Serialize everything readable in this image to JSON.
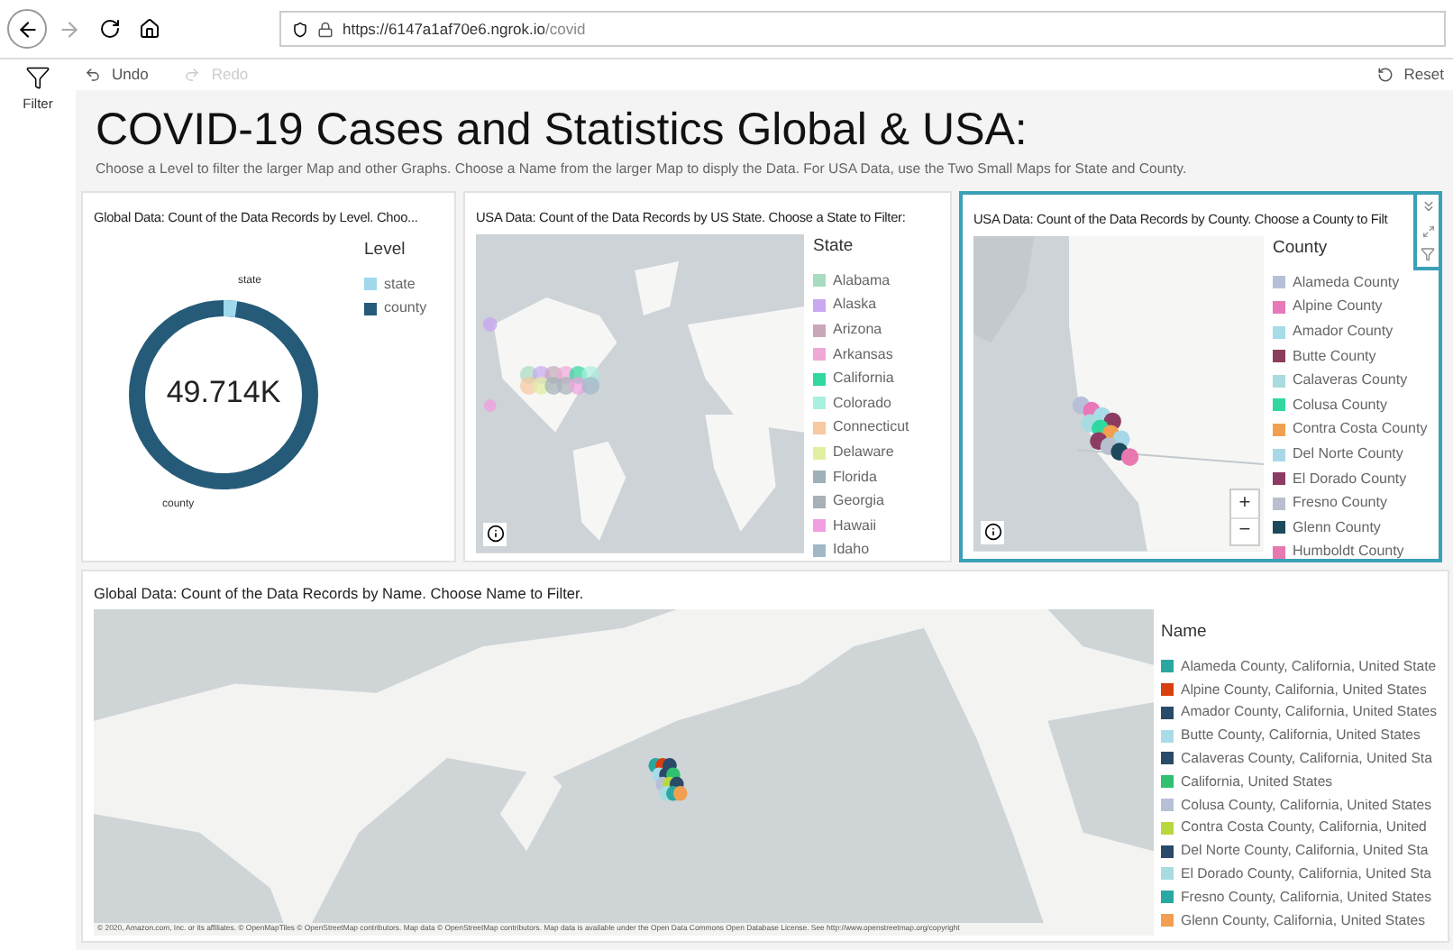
{
  "browser": {
    "url_host": "https://6147a1af70e6.ngrok.io",
    "url_path": "/covid"
  },
  "sidebar": {
    "items": [
      {
        "label": "Filter"
      }
    ]
  },
  "toolbar": {
    "undo": {
      "label": "Undo",
      "disabled": false
    },
    "redo": {
      "label": "Redo",
      "disabled": true
    },
    "reset": {
      "label": "Reset",
      "disabled": false
    }
  },
  "title": "COVID-19 Cases and Statistics Global & USA:",
  "subtitle": "Choose a Level to filter the larger Map and other Graphs. Choose a Name from the larger Map to disply the Data. For USA Data, use the Two Small Maps for State and County.",
  "visuals": [
    {
      "kind": "donut",
      "title": "Global Data: Count of the Data Records by Level. Choo...",
      "selected": false,
      "total": "49.714K",
      "slice_labels": [
        "state",
        "county"
      ],
      "legend": {
        "title": "Level",
        "items": [
          {
            "label": "state",
            "color": "#a0d8ec"
          },
          {
            "label": "county",
            "color": "#255b78"
          }
        ]
      }
    },
    {
      "kind": "map",
      "title": "USA Data: Count of the Data Records by US State. Choose a State to Filter:",
      "selected": false,
      "zoom_controls": false,
      "legend": {
        "title": "State",
        "items": [
          {
            "label": "Alabama",
            "color": "#a8dcc0"
          },
          {
            "label": "Alaska",
            "color": "#c8a8f0"
          },
          {
            "label": "Arizona",
            "color": "#c8a8b8"
          },
          {
            "label": "Arkansas",
            "color": "#f0a8d8"
          },
          {
            "label": "California",
            "color": "#30d8a0"
          },
          {
            "label": "Colorado",
            "color": "#a8f0e0"
          },
          {
            "label": "Connecticut",
            "color": "#f8c8a0"
          },
          {
            "label": "Delaware",
            "color": "#e0f0a0"
          },
          {
            "label": "Florida",
            "color": "#a0b0b8"
          },
          {
            "label": "Georgia",
            "color": "#a8b0b8"
          },
          {
            "label": "Hawaii",
            "color": "#f0a0e0"
          },
          {
            "label": "Idaho",
            "color": "#a0b8c8"
          }
        ]
      }
    },
    {
      "kind": "map",
      "title": "USA Data: Count of the Data Records by County. Choose a County to Filt",
      "selected": true,
      "zoom_controls": true,
      "zoom_in": "+",
      "zoom_out": "−",
      "legend": {
        "title": "County",
        "items": [
          {
            "label": "Alameda County",
            "color": "#b8c0d8"
          },
          {
            "label": "Alpine County",
            "color": "#e878b8"
          },
          {
            "label": "Amador County",
            "color": "#a8dce8"
          },
          {
            "label": "Butte County",
            "color": "#8c3c60"
          },
          {
            "label": "Calaveras County",
            "color": "#a8dce0"
          },
          {
            "label": "Colusa County",
            "color": "#30d8a0"
          },
          {
            "label": "Contra Costa County",
            "color": "#f0a050"
          },
          {
            "label": "Del Norte County",
            "color": "#a8d8e8"
          },
          {
            "label": "El Dorado County",
            "color": "#8c3c62"
          },
          {
            "label": "Fresno County",
            "color": "#b8c0d0"
          },
          {
            "label": "Glenn County",
            "color": "#1c4a5c"
          },
          {
            "label": "Humboldt County",
            "color": "#e878b0"
          }
        ]
      }
    }
  ],
  "global_map": {
    "title": "Global Data: Count of the Data Records by Name. Choose Name to Filter.",
    "selected": false,
    "attribution": "© 2020, Amazon.com, Inc. or its affiliates. © OpenMapTiles © OpenStreetMap contributors. Map data © OpenStreetMap contributors. Map data is available under the Open Data Commons Open Database License. See http://www.openstreetmap.org/copyright",
    "legend": {
      "title": "Name",
      "items": [
        {
          "label": "Alameda County, California, United State",
          "color": "#2aa8a0"
        },
        {
          "label": "Alpine County, California, United States",
          "color": "#d84010"
        },
        {
          "label": "Amador County, California, United States",
          "color": "#2a4a6a"
        },
        {
          "label": "Butte County, California, United States",
          "color": "#a8dce8"
        },
        {
          "label": "Calaveras County, California, United Sta",
          "color": "#2a4a6c"
        },
        {
          "label": "California, United States",
          "color": "#30c070"
        },
        {
          "label": "Colusa County, California, United States",
          "color": "#b8c0d8"
        },
        {
          "label": "Contra Costa County, California, United",
          "color": "#b8d840"
        },
        {
          "label": "Del Norte County, California, United Sta",
          "color": "#2a4a68"
        },
        {
          "label": "El Dorado County, California, United Sta",
          "color": "#a8dce0"
        },
        {
          "label": "Fresno County, California, United States",
          "color": "#2aa8a2"
        },
        {
          "label": "Glenn County, California, United States",
          "color": "#f0a050"
        }
      ]
    }
  }
}
